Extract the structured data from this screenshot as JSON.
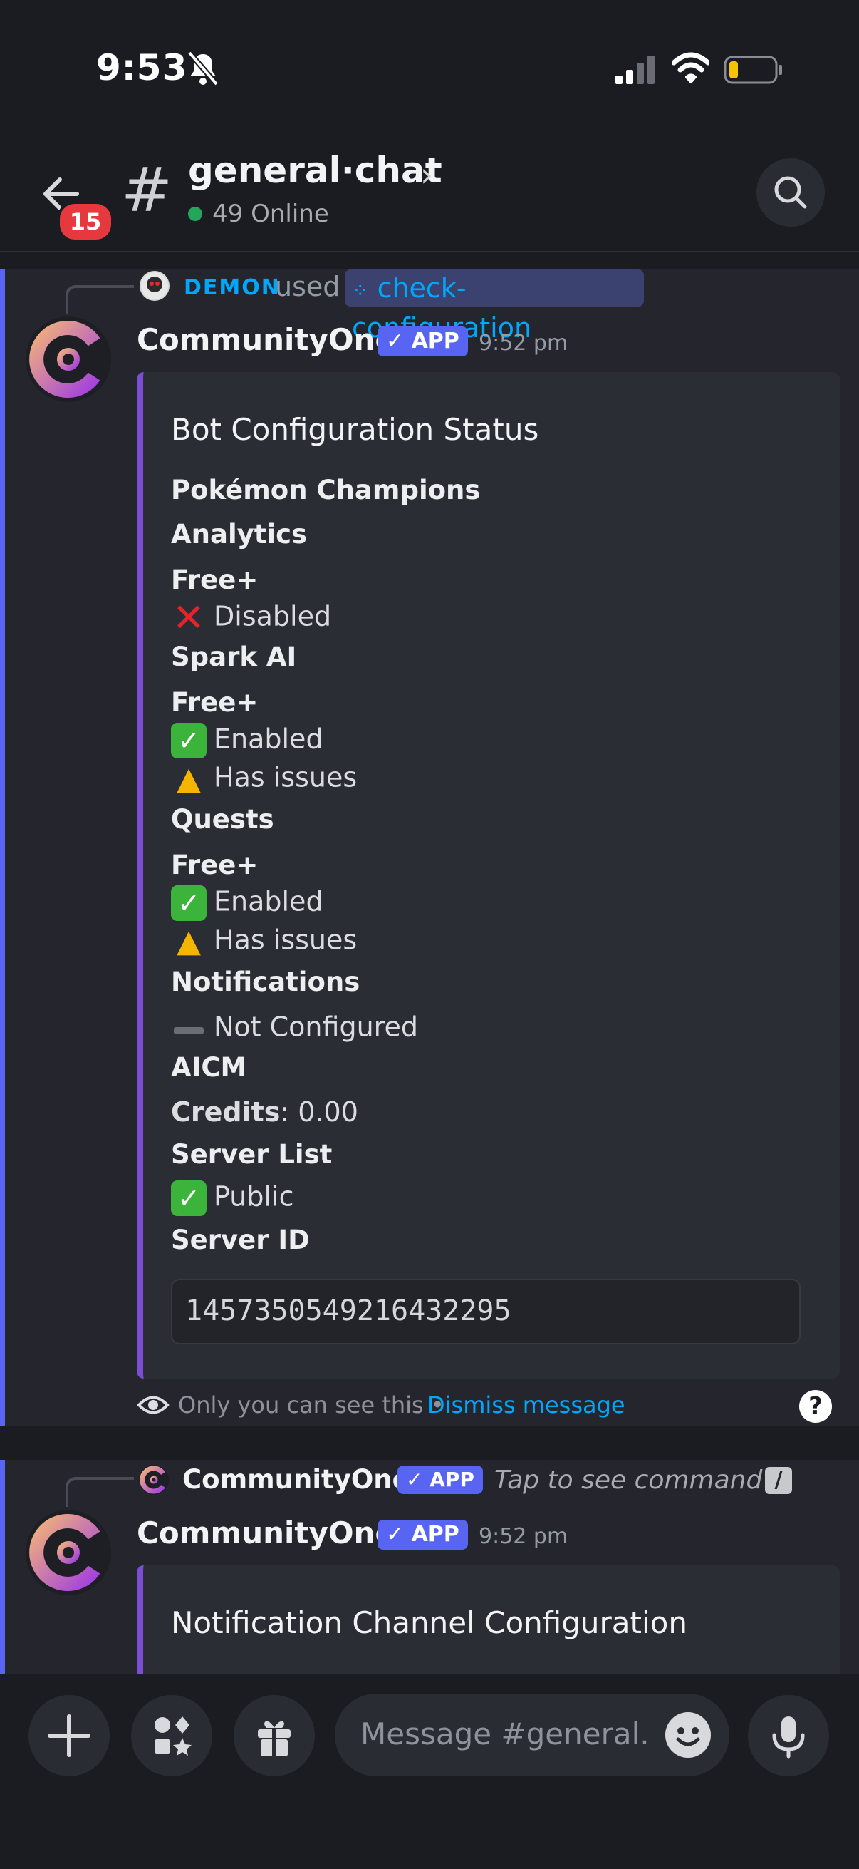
{
  "status_bar": {
    "time": "9:53"
  },
  "header": {
    "back_badge": "15",
    "channel_hash": "#",
    "channel_name": "general·chat",
    "online": "49 Online"
  },
  "message1": {
    "invoker": "DEMON",
    "used": "used",
    "command": "check-configuration",
    "author": "CommunityOne",
    "app_tag": "✓ APP",
    "time": "9:52 pm",
    "embed": {
      "title": "Bot Configuration Status",
      "lines": [
        "Pokémon Champions",
        "Analytics",
        "Free+",
        "Disabled",
        "Spark AI",
        "Free+",
        "Enabled",
        "Has issues",
        "Quests",
        "Free+",
        "Enabled",
        "Has issues",
        "Notifications",
        "Not Configured",
        "AICM",
        "Credits",
        ": 0.00",
        "Server List",
        "Public",
        "Server ID"
      ],
      "server_id": "1457350549216432295"
    },
    "ephemeral_text": "Only you can see this •",
    "dismiss": "Dismiss message",
    "help": "?"
  },
  "message2": {
    "reply_author": "CommunityOne",
    "reply_app_tag": "✓ APP",
    "tap_text": "Tap to see command",
    "author": "CommunityOne",
    "app_tag": "✓ APP",
    "time": "9:52 pm",
    "embed_title": "Notification Channel Configuration"
  },
  "composer": {
    "placeholder": "Message #general..."
  },
  "colors": {
    "accent": "#5865f2",
    "embed_bar": "#7a4fd6",
    "link": "#00a8fc",
    "online": "#23a55a",
    "badge": "#e5393e"
  }
}
